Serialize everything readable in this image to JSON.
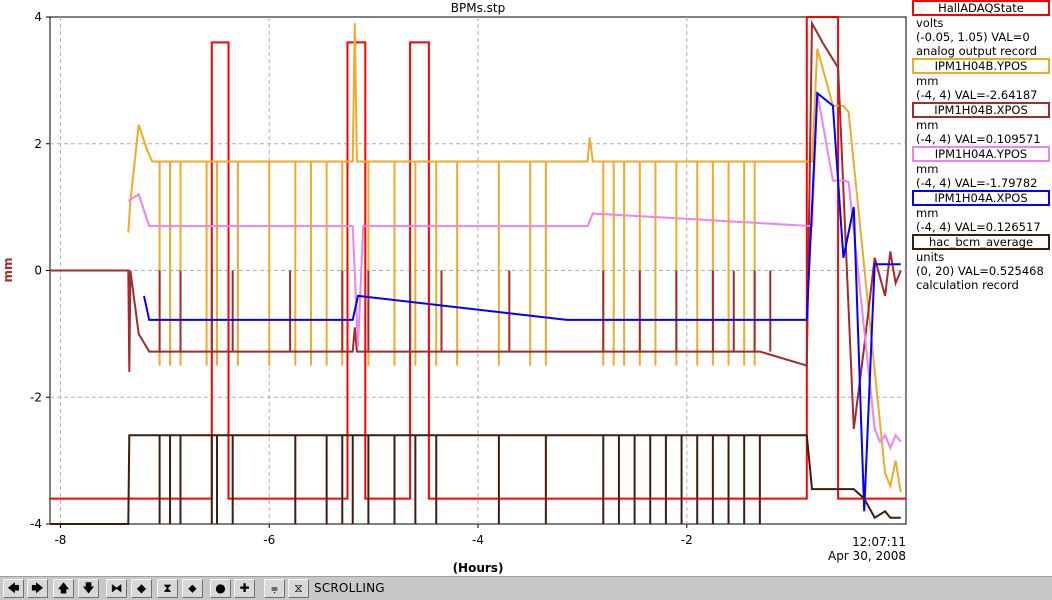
{
  "chart_data": {
    "type": "line",
    "title": "BPMs.stp",
    "xlabel": "(Hours)",
    "ylabel": "mm",
    "xlim": [
      -8.1,
      0.1
    ],
    "ylim": [
      -4,
      4
    ],
    "x_ticks": [
      -8,
      -6,
      -4,
      -2
    ],
    "x_tick_labels": [
      "-8",
      "-6",
      "-4",
      "-2"
    ],
    "y_ticks": [
      -4,
      -2,
      0,
      2,
      4
    ],
    "y_tick_labels": [
      "-4",
      "-2",
      "0",
      "2",
      "4"
    ],
    "end_time": "12:07:11",
    "end_date": "Apr 30, 2008",
    "grid": true,
    "series": [
      {
        "name": "HallADAQState",
        "color": "#ff0000",
        "x": [
          -8.1,
          -6.55,
          -6.55,
          -6.39,
          -6.39,
          -5.25,
          -5.25,
          -5.08,
          -5.08,
          -4.65,
          -4.65,
          -4.47,
          -4.47,
          -0.85,
          -0.85,
          -0.55,
          -0.55,
          0.1
        ],
        "y": [
          -3.6,
          -3.6,
          3.6,
          3.6,
          -3.6,
          -3.6,
          3.6,
          3.6,
          -3.6,
          -3.6,
          3.6,
          3.6,
          -3.6,
          -3.6,
          4,
          4,
          -3.6,
          -3.6
        ]
      },
      {
        "name": "IPM1H04B.YPOS",
        "color": "#f0aa28",
        "x": [
          -7.35,
          -7.33,
          -7.25,
          -7.17,
          -7.12,
          -5.2,
          -5.18,
          -5.16,
          -3.15,
          -2.95,
          -2.93,
          -2.9,
          -0.8,
          -0.75,
          -0.6,
          -0.5,
          -0.45,
          -0.1,
          -0.05,
          0.0,
          0.05
        ],
        "y": [
          0.6,
          1.1,
          2.3,
          1.9,
          1.72,
          1.72,
          3.9,
          1.72,
          1.72,
          1.72,
          2.1,
          1.72,
          1.72,
          3.5,
          2.6,
          2.6,
          2.5,
          -3.2,
          -3.4,
          -3.0,
          -3.5
        ]
      },
      {
        "name": "IPM1H04B.XPOS",
        "color": "#a52a2a",
        "x": [
          -8.1,
          -7.35,
          -7.34,
          -7.33,
          -7.25,
          -7.15,
          -5.2,
          -5.18,
          -5.16,
          -3.15,
          -2.95,
          -2.9,
          -1.3,
          -0.85,
          -0.8,
          -0.7,
          -0.55,
          -0.4,
          -0.3,
          -0.2,
          -0.1,
          -0.05,
          0.0,
          0.05
        ],
        "y": [
          0,
          0,
          -1.6,
          0,
          -1.0,
          -1.28,
          -1.28,
          -0.9,
          -1.28,
          -1.28,
          -1.28,
          -1.28,
          -1.28,
          -1.5,
          3.9,
          3.6,
          3.2,
          -2.5,
          -1.2,
          0.2,
          -0.4,
          0.3,
          -0.2,
          0.0
        ]
      },
      {
        "name": "IPM1H04A.YPOS",
        "color": "#ee82ee",
        "x": [
          -7.35,
          -7.25,
          -7.15,
          -5.2,
          -5.15,
          -5.1,
          -3.15,
          -2.95,
          -2.9,
          -0.8,
          -0.75,
          -0.6,
          -0.5,
          -0.45,
          -0.2,
          -0.15,
          -0.1,
          -0.05,
          0.0,
          0.05
        ],
        "y": [
          1.1,
          1.2,
          0.7,
          0.7,
          -1.2,
          0.7,
          0.7,
          0.7,
          0.9,
          0.7,
          2.8,
          1.42,
          1.42,
          1.4,
          -2.5,
          -2.7,
          -2.6,
          -2.8,
          -2.6,
          -2.7
        ]
      },
      {
        "name": "IPM1H04A.XPOS",
        "color": "#0000ff",
        "x": [
          -7.2,
          -7.15,
          -5.2,
          -5.15,
          -3.15,
          -2.95,
          -2.9,
          -1.3,
          -0.85,
          -0.75,
          -0.6,
          -0.5,
          -0.4,
          -0.3,
          -0.2,
          -0.1,
          0.0,
          0.05
        ],
        "y": [
          -0.4,
          -0.78,
          -0.78,
          -0.4,
          -0.78,
          -0.78,
          -0.78,
          -0.78,
          -0.78,
          2.8,
          2.6,
          0.2,
          1.0,
          -3.8,
          0.1,
          0.1,
          0.1,
          0.1
        ]
      },
      {
        "name": "hac_bcm_average",
        "color": "#3c1e0f",
        "x": [
          -8.1,
          -7.35,
          -7.34,
          -7.2,
          -5.2,
          -5.18,
          -3.15,
          -2.95,
          -2.93,
          -2.9,
          -1.3,
          -0.85,
          -0.8,
          -0.4,
          -0.3,
          -0.2,
          -0.1,
          -0.05,
          0.05
        ],
        "y": [
          -4,
          -4,
          -2.6,
          -2.6,
          -2.6,
          -2.6,
          -2.6,
          -2.6,
          -2.6,
          -2.6,
          -2.6,
          -2.6,
          -3.45,
          -3.45,
          -3.6,
          -3.9,
          -3.8,
          -3.9,
          -3.9
        ]
      }
    ],
    "dropouts": [
      {
        "name": "IPM1H04B.YPOS",
        "to": -1.5,
        "x": [
          -7.05,
          -6.95,
          -6.85,
          -6.6,
          -6.5,
          -6.3,
          -6.0,
          -5.75,
          -5.6,
          -5.45,
          -5.3,
          -5.05,
          -4.8,
          -4.6,
          -4.4,
          -4.2,
          -3.8,
          -3.5,
          -3.35,
          -2.8,
          -2.7,
          -2.6,
          -2.45,
          -2.3,
          -2.1,
          -1.9,
          -1.75,
          -1.6,
          -1.45,
          -1.35
        ]
      },
      {
        "name": "IPM1H04B.XPOS",
        "to": 0,
        "x": [
          -7.05,
          -6.85,
          -6.55,
          -6.35,
          -5.8,
          -5.3,
          -5.05,
          -4.65,
          -4.35,
          -3.7,
          -2.8,
          -2.45,
          -2.1,
          -1.75,
          -1.55,
          -1.35,
          -1.2
        ]
      },
      {
        "name": "hac_bcm_average",
        "to": -4,
        "x": [
          -7.05,
          -6.95,
          -6.85,
          -6.55,
          -6.5,
          -6.35,
          -5.75,
          -5.45,
          -5.3,
          -5.2,
          -5.05,
          -4.8,
          -4.6,
          -4.4,
          -3.8,
          -3.35,
          -2.8,
          -2.65,
          -2.5,
          -2.35,
          -2.2,
          -2.05,
          -1.9,
          -1.75,
          -1.6,
          -1.45,
          -1.3
        ]
      }
    ]
  },
  "legend": [
    {
      "name": "HallADAQState",
      "color": "#ff0000",
      "lines": [
        "volts",
        "(-0.05, 1.05) VAL=0",
        "analog output record"
      ]
    },
    {
      "name": "IPM1H04B.YPOS",
      "color": "#f0aa28",
      "lines": [
        "mm",
        "(-4, 4) VAL=-2.64187"
      ]
    },
    {
      "name": "IPM1H04B.XPOS",
      "color": "#a52a2a",
      "lines": [
        "mm",
        "(-4, 4) VAL=0.109571"
      ]
    },
    {
      "name": "IPM1H04A.YPOS",
      "color": "#ee82ee",
      "lines": [
        "mm",
        "(-4, 4) VAL=-1.79782"
      ]
    },
    {
      "name": "IPM1H04A.XPOS",
      "color": "#0000ff",
      "lines": [
        "mm",
        "(-4, 4) VAL=0.126517"
      ]
    },
    {
      "name": "hac_bcm_average",
      "color": "#3c1e0f",
      "lines": [
        "units",
        "(0, 20) VAL=0.525468",
        "calculation record"
      ]
    }
  ],
  "toolbar": {
    "buttons": [
      {
        "name": "scroll-left-button",
        "glyph": "🡄"
      },
      {
        "name": "scroll-right-button",
        "glyph": "🡆"
      },
      {
        "name": "scroll-up-button",
        "glyph": "🡅"
      },
      {
        "name": "scroll-down-button",
        "glyph": "🡇"
      },
      {
        "name": "zoom-in-x-button",
        "glyph": "⧓"
      },
      {
        "name": "zoom-out-x-button",
        "glyph": "◆"
      },
      {
        "name": "zoom-in-y-button",
        "glyph": "⧗"
      },
      {
        "name": "zoom-out-y-button",
        "glyph": "⬥"
      },
      {
        "name": "auto-scale-button",
        "glyph": "●"
      },
      {
        "name": "center-button",
        "glyph": "✚"
      },
      {
        "name": "reset-button",
        "glyph": "⩦"
      },
      {
        "name": "pause-button",
        "glyph": "⧖"
      }
    ],
    "status": "SCROLLING"
  }
}
